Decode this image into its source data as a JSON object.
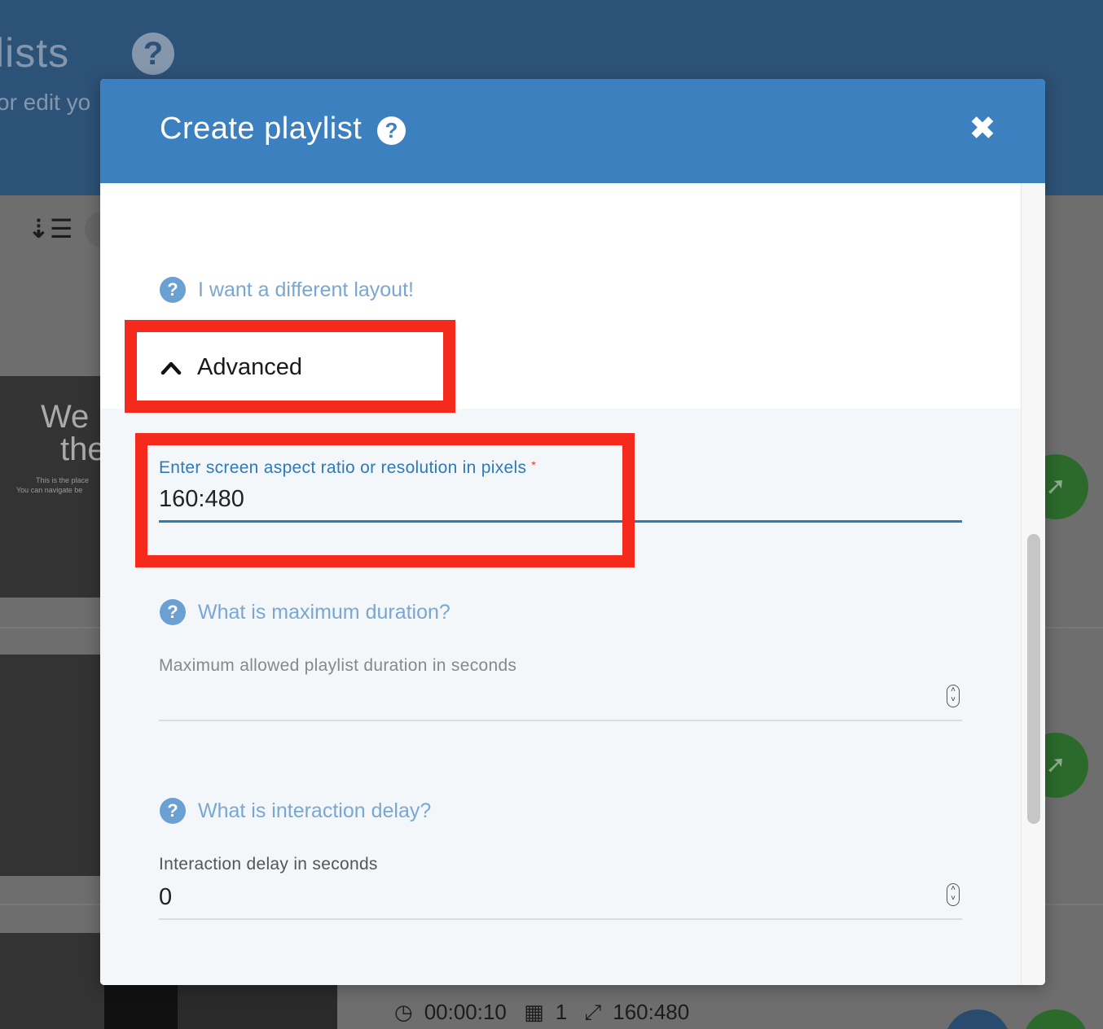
{
  "background": {
    "title": "ylists",
    "subtitle": "or edit yo",
    "card_title_1": "We",
    "card_title_2": "the",
    "card_tiny_1": "This is the place",
    "card_tiny_2": "You can navigate be",
    "meta": {
      "duration": "00:00:10",
      "items": "1",
      "resolution": "160:480"
    }
  },
  "modal": {
    "title": "Create playlist",
    "help_glyph": "?",
    "close_glyph": "✖"
  },
  "layout_link": {
    "label": "I want a different layout!"
  },
  "advanced": {
    "label": "Advanced"
  },
  "resolution_field": {
    "label": "Enter screen aspect ratio or resolution in pixels",
    "required_mark": "*",
    "value": "160:480"
  },
  "duration_help": {
    "label": "What is maximum duration?"
  },
  "duration_field": {
    "label": "Maximum allowed playlist duration in seconds",
    "value": ""
  },
  "delay_help": {
    "label": "What is interaction delay?"
  },
  "delay_field": {
    "label": "Interaction delay in seconds",
    "value": "0"
  },
  "icons": {
    "help": "question-circle-icon",
    "close": "close-icon",
    "chevron": "chevron-up-icon",
    "sort": "sort-icon",
    "rocket": "rocket-icon",
    "clock": "clock-icon",
    "grid": "grid-icon",
    "resize": "resize-icon"
  },
  "colors": {
    "header": "#3d80bf",
    "link": "#7aa7d2",
    "accent_blue": "#2f79b9",
    "annotation_red": "#f52a1c"
  }
}
